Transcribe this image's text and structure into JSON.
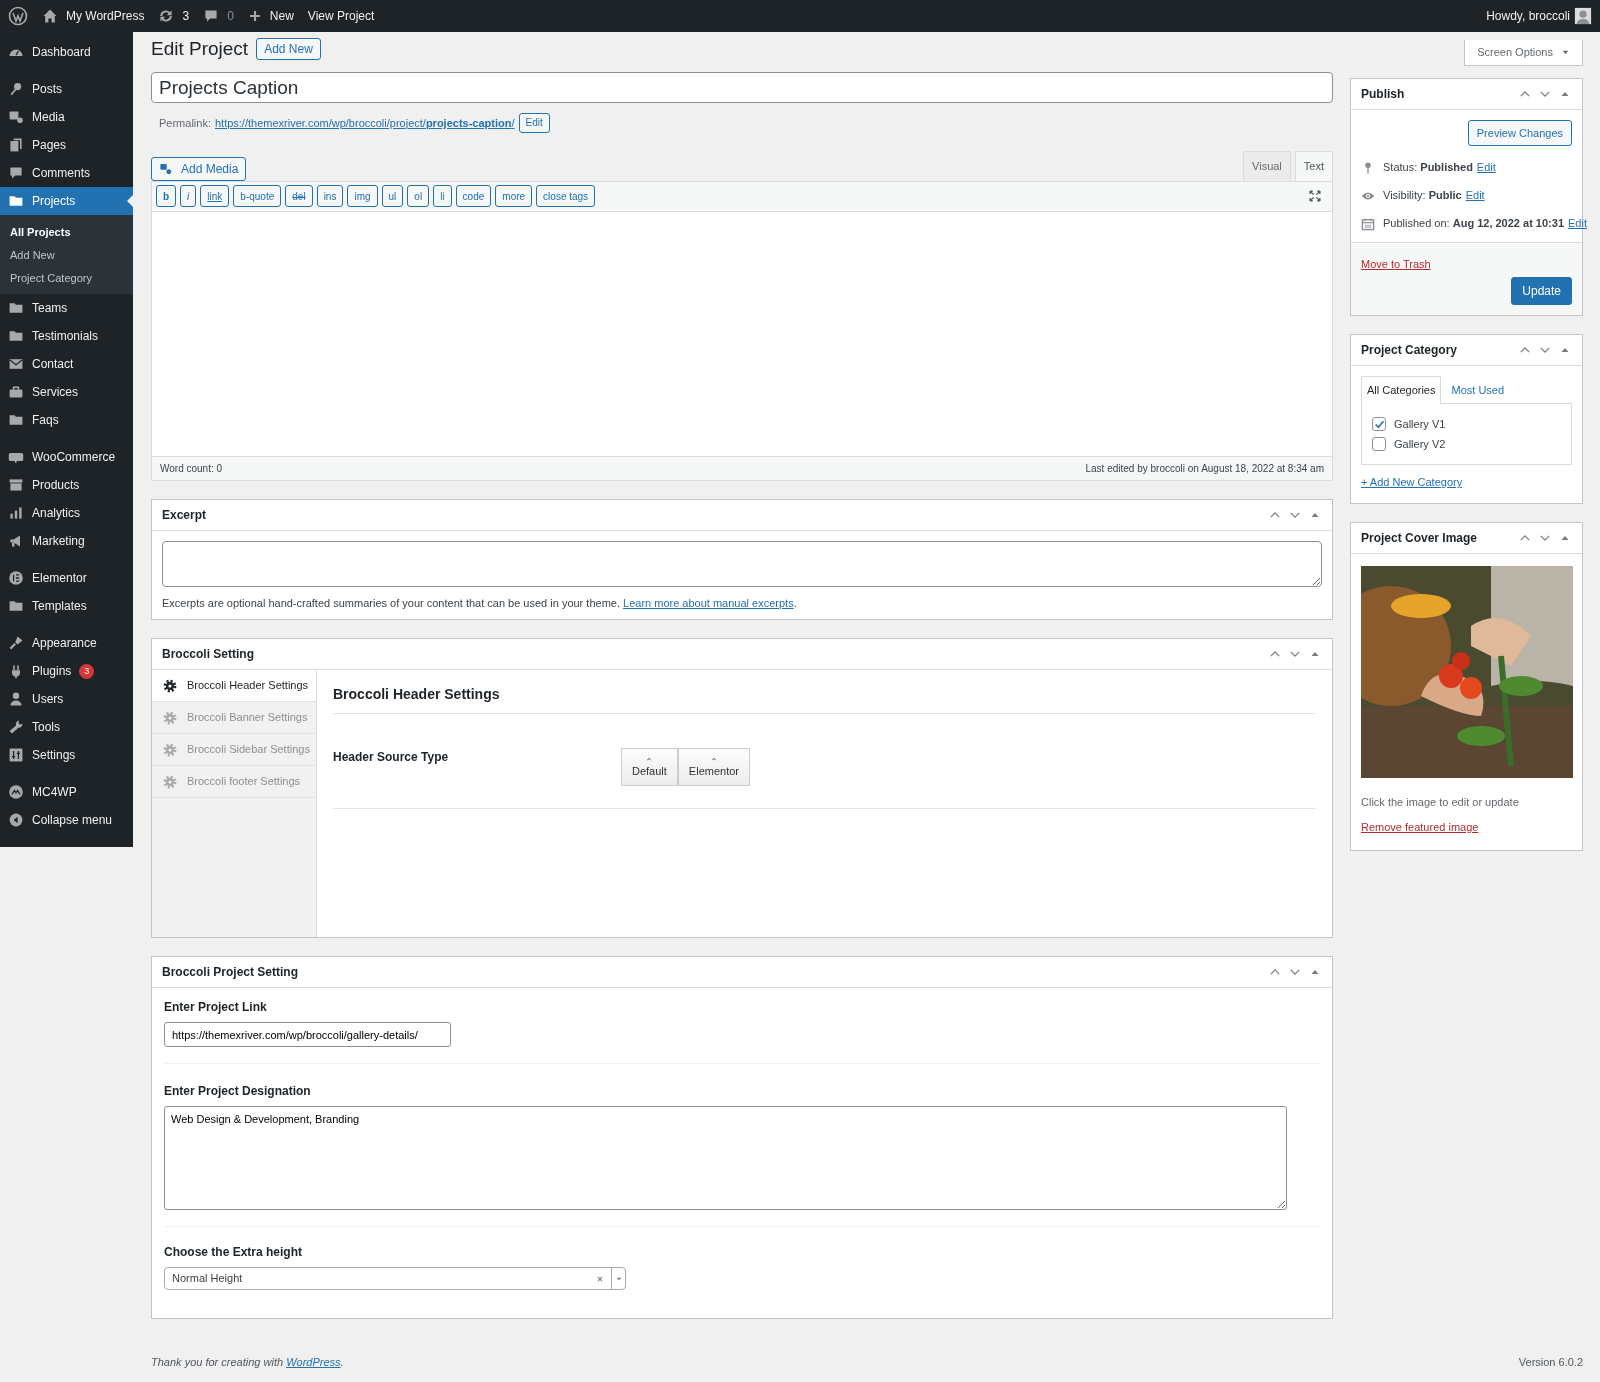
{
  "admin_bar": {
    "site": "My WordPress",
    "updates": "3",
    "comments": "0",
    "new": "New",
    "view": "View Project",
    "greeting": "Howdy, broccoli"
  },
  "sidebar": {
    "groups": [
      [
        {
          "label": "Dashboard",
          "selected": false
        }
      ],
      [
        {
          "label": "Posts",
          "selected": false
        },
        {
          "label": "Media",
          "selected": false
        },
        {
          "label": "Pages",
          "selected": false
        },
        {
          "label": "Comments",
          "selected": false
        },
        {
          "label": "Projects",
          "selected": true,
          "children": [
            {
              "label": "All Projects",
              "selected": true
            },
            {
              "label": "Add New",
              "selected": false
            },
            {
              "label": "Project Category",
              "selected": false
            }
          ]
        },
        {
          "label": "Teams",
          "selected": false
        },
        {
          "label": "Testimonials",
          "selected": false
        },
        {
          "label": "Contact",
          "selected": false
        },
        {
          "label": "Services",
          "selected": false
        },
        {
          "label": "Faqs",
          "selected": false
        }
      ],
      [
        {
          "label": "WooCommerce",
          "selected": false
        },
        {
          "label": "Products",
          "selected": false
        },
        {
          "label": "Analytics",
          "selected": false
        },
        {
          "label": "Marketing",
          "selected": false
        }
      ],
      [
        {
          "label": "Elementor",
          "selected": false
        },
        {
          "label": "Templates",
          "selected": false
        }
      ],
      [
        {
          "label": "Appearance",
          "selected": false
        },
        {
          "label": "Plugins",
          "selected": false,
          "badge": "3"
        },
        {
          "label": "Users",
          "selected": false
        },
        {
          "label": "Tools",
          "selected": false
        },
        {
          "label": "Settings",
          "selected": false
        }
      ],
      [
        {
          "label": "MC4WP",
          "selected": false
        },
        {
          "label": "Collapse menu",
          "selected": false
        }
      ]
    ]
  },
  "header": {
    "title": "Edit Project",
    "add_new": "Add New",
    "screen_options": "Screen Options"
  },
  "post_title": {
    "value": "Projects Caption"
  },
  "permalink": {
    "label": "Permalink:",
    "url": "https://themexriver.com/wp/broccoli/project/**projects-caption**/",
    "edit": "Edit"
  },
  "editor": {
    "add_media": "Add Media",
    "tabs": [
      {
        "label": "Visual",
        "selected": false
      },
      {
        "label": "Text",
        "selected": true
      }
    ],
    "quicktags": [
      {
        "label": "b",
        "kind": "bold"
      },
      {
        "label": "i",
        "kind": "italic"
      },
      {
        "label": "link",
        "kind": "link"
      },
      {
        "label": "b-quote",
        "kind": "plain"
      },
      {
        "label": "del",
        "kind": "del"
      },
      {
        "label": "ins",
        "kind": "plain"
      },
      {
        "label": "img",
        "kind": "plain"
      },
      {
        "label": "ul",
        "kind": "plain"
      },
      {
        "label": "ol",
        "kind": "plain"
      },
      {
        "label": "li",
        "kind": "plain"
      },
      {
        "label": "code",
        "kind": "plain"
      },
      {
        "label": "more",
        "kind": "plain"
      },
      {
        "label": "close tags",
        "kind": "plain"
      }
    ],
    "word_count": "Word count: 0",
    "last_edited": "Last edited by broccoli on August 18, 2022 at 8:34 am"
  },
  "excerpt": {
    "title": "Excerpt",
    "help": "Excerpts are optional hand-crafted summaries of your content that can be used in your theme.",
    "link": "Learn more about manual excerpts",
    "after": "."
  },
  "broccoli_setting": {
    "title": "Broccoli Setting",
    "tabs": [
      {
        "label": "Broccoli Header Settings",
        "selected": true
      },
      {
        "label": "Broccoli Banner Settings",
        "selected": false
      },
      {
        "label": "Broccoli Sidebar Settings",
        "selected": false
      },
      {
        "label": "Broccoli footer Settings",
        "selected": false
      }
    ],
    "panel_title": "Broccoli Header Settings",
    "field_label": "Header Source Type",
    "options": [
      "Default",
      "Elementor"
    ]
  },
  "project_setting": {
    "title": "Broccoli Project Setting",
    "link_label": "Enter Project Link",
    "link_value": "https://themexriver.com/wp/broccoli/gallery-details/",
    "designation_label": "Enter Project Designation",
    "designation_value": "Web Design & Development, Branding",
    "height_label": "Choose the Extra height",
    "height_value": "Normal Height"
  },
  "publish": {
    "title": "Publish",
    "preview": "Preview Changes",
    "rows": [
      {
        "text": "Status: **Published**",
        "edit": "Edit"
      },
      {
        "text": "Visibility: **Public**",
        "edit": "Edit"
      },
      {
        "text": "Published on: **Aug 12, 2022 at 10:31**",
        "edit": "Edit"
      }
    ],
    "trash": "Move to Trash",
    "update": "Update"
  },
  "category": {
    "title": "Project Category",
    "tabs": [
      {
        "label": "All Categories",
        "selected": true
      },
      {
        "label": "Most Used",
        "selected": false
      }
    ],
    "items": [
      {
        "label": "Gallery V1",
        "checked": true
      },
      {
        "label": "Gallery V2",
        "checked": false
      }
    ],
    "add": "+ Add New Category"
  },
  "cover": {
    "title": "Project Cover Image",
    "hint": "Click the image to edit or update",
    "remove": "Remove featured image"
  },
  "footer": {
    "thanks": "Thank you for creating with",
    "link": "WordPress",
    "after": ".",
    "version": "Version 6.0.2"
  }
}
